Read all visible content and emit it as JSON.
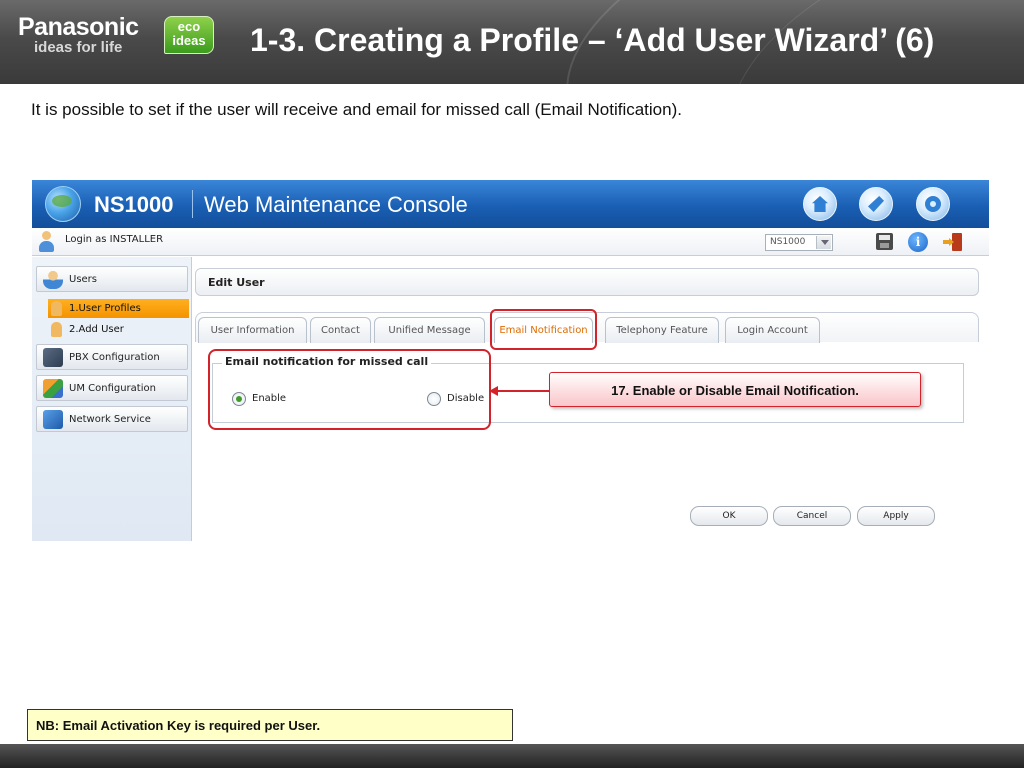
{
  "slide": {
    "brand": "Panasonic",
    "brand_tagline": "ideas for life",
    "eco_badge": [
      "eco",
      "ideas"
    ],
    "title": "1-3. Creating a Profile – ‘Add User Wizard’ (6)",
    "intro": "It is possible to set if the user will receive and email for missed call (Email Notification).",
    "callout": "17. Enable or Disable Email Notification.",
    "note": "NB: Email Activation Key is required per User."
  },
  "console": {
    "product": "NS1000",
    "app_name": "Web Maintenance Console",
    "top_icons": [
      "home-icon",
      "tool-icon",
      "gear-icon"
    ],
    "login_text": "Login as INSTALLER",
    "site_select": "NS1000",
    "toolbar_icons": [
      "save-icon",
      "info-icon",
      "logout-icon"
    ],
    "sidebar": {
      "sections": [
        {
          "label": "Users",
          "icon": "users-icon"
        },
        {
          "label": "PBX Configuration",
          "icon": "pbx-icon"
        },
        {
          "label": "UM Configuration",
          "icon": "um-icon"
        },
        {
          "label": "Network Service",
          "icon": "network-icon"
        }
      ],
      "user_items": [
        {
          "label": "1.User Profiles",
          "active": true
        },
        {
          "label": "2.Add User",
          "active": false
        }
      ]
    },
    "edit_header": "Edit User",
    "tabs": [
      {
        "label": "User Information",
        "active": false
      },
      {
        "label": "Contact",
        "active": false
      },
      {
        "label": "Unified Message",
        "active": false
      },
      {
        "label": "Email Notification",
        "active": true
      },
      {
        "label": "Telephony Feature",
        "active": false
      },
      {
        "label": "Login Account",
        "active": false
      }
    ],
    "email_notification": {
      "legend": "Email notification for missed call",
      "options": [
        {
          "label": "Enable",
          "checked": true
        },
        {
          "label": "Disable",
          "checked": false
        }
      ]
    },
    "buttons": {
      "ok": "OK",
      "cancel": "Cancel",
      "apply": "Apply"
    }
  },
  "colors": {
    "highlight_red": "#d2232a",
    "active_tab_text": "#e06a00",
    "active_sidebar_item": "#f49300",
    "console_blue": "#1a5fb4",
    "note_background": "#ffffc8"
  }
}
